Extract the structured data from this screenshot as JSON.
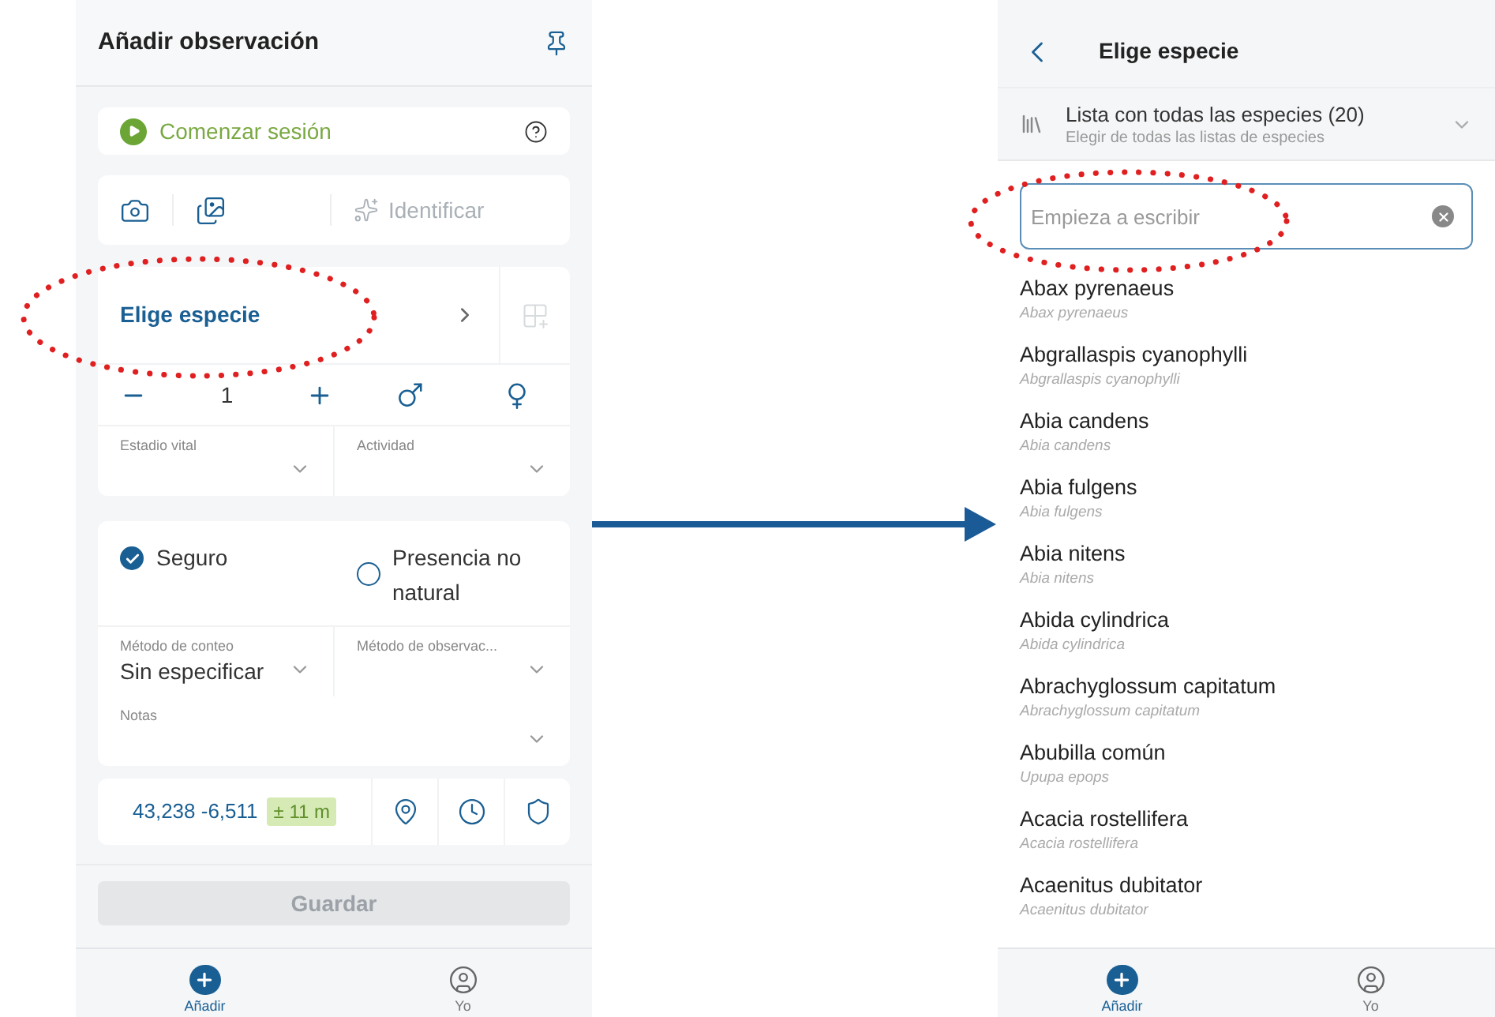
{
  "add_screen": {
    "title": "Añadir observación",
    "session": {
      "label": "Comenzar sesión"
    },
    "media": {
      "identify_label": "Identificar"
    },
    "species": {
      "label": "Elige especie"
    },
    "count": {
      "value": "1"
    },
    "life_stage": {
      "label": "Estadio vital"
    },
    "activity": {
      "label": "Actividad"
    },
    "toggles": [
      {
        "label": "Seguro",
        "checked": true
      },
      {
        "label": "Presencia no natural",
        "checked": false
      }
    ],
    "count_method": {
      "label": "Método de conteo",
      "value": "Sin especificar"
    },
    "obs_method": {
      "label": "Método de observac..."
    },
    "notes": {
      "label": "Notas"
    },
    "location": {
      "coords": "43,238 -6,511",
      "accuracy": "± 11 m"
    },
    "save": {
      "label": "Guardar",
      "disabled": true
    },
    "nav": [
      {
        "kind": "add",
        "label": "Añadir",
        "selected": true
      },
      {
        "kind": "profile",
        "label": "Yo",
        "selected": false
      }
    ]
  },
  "species_screen": {
    "title": "Elige especie",
    "list": {
      "title": "Lista con todas las especies (20)",
      "subtitle": "Elegir de todas las listas de especies"
    },
    "search": {
      "placeholder": "Empieza a escribir"
    },
    "species": [
      {
        "name": "Abax pyrenaeus",
        "scientific": "Abax pyrenaeus"
      },
      {
        "name": "Abgrallaspis cyanophylli",
        "scientific": "Abgrallaspis cyanophylli"
      },
      {
        "name": "Abia candens",
        "scientific": "Abia candens"
      },
      {
        "name": "Abia fulgens",
        "scientific": "Abia fulgens"
      },
      {
        "name": "Abia nitens",
        "scientific": "Abia nitens"
      },
      {
        "name": "Abida cylindrica",
        "scientific": "Abida cylindrica"
      },
      {
        "name": "Abrachyglossum capitatum",
        "scientific": "Abrachyglossum capitatum"
      },
      {
        "name": "Abubilla común",
        "scientific": "Upupa epops"
      },
      {
        "name": "Acacia rostellifera",
        "scientific": "Acacia rostellifera"
      },
      {
        "name": "Acaenitus dubitator",
        "scientific": "Acaenitus dubitator"
      }
    ],
    "nav": [
      {
        "kind": "add",
        "label": "Añadir",
        "selected": true
      },
      {
        "kind": "profile",
        "label": "Yo",
        "selected": false
      }
    ]
  }
}
